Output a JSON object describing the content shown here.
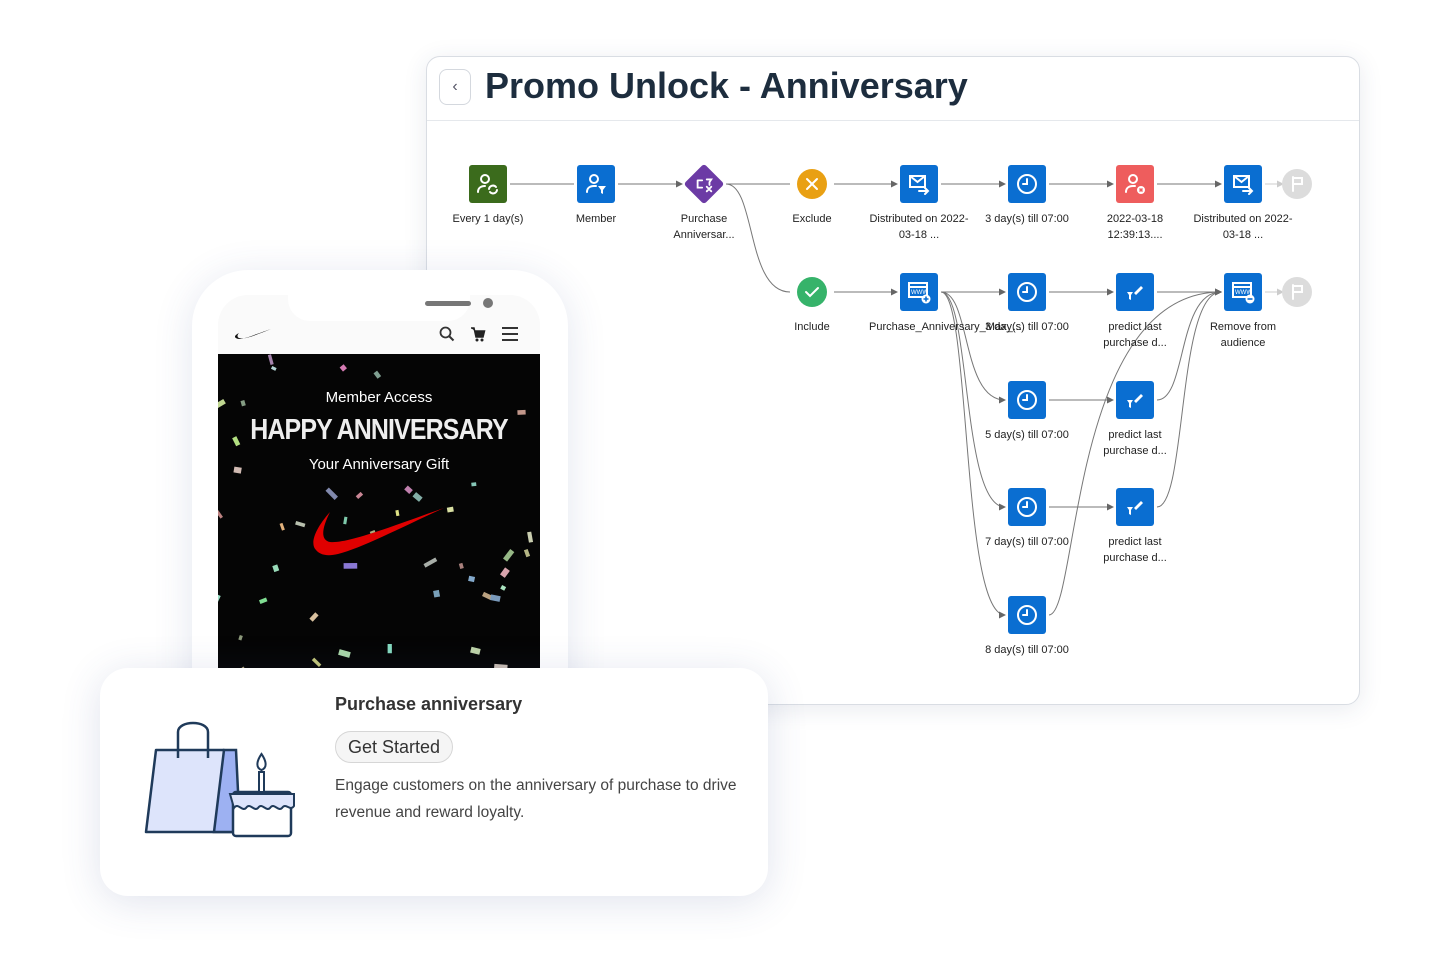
{
  "header": {
    "title": "Promo Unlock - Anniversary",
    "back_icon": "chevron-left-icon"
  },
  "colors": {
    "green": "#3b6b1c",
    "blue": "#0a6ed1",
    "purple": "#6c3ba5",
    "orange": "#e9a013",
    "success": "#36b36a",
    "red": "#ee5d5d",
    "flag": "#dcdcdc",
    "title": "#1d2d3e"
  },
  "flow": {
    "nodes": [
      {
        "id": "every",
        "label": "Every 1 day(s)",
        "icon": "user-refresh-icon"
      },
      {
        "id": "member",
        "label": "Member",
        "icon": "user-filter-icon"
      },
      {
        "id": "purchase",
        "label": "Purchase Anniversar...",
        "icon": "split-filter-icon"
      },
      {
        "id": "exclude",
        "label": "Exclude",
        "icon": "x-circle-icon"
      },
      {
        "id": "dist1",
        "label": "Distributed on 2022-03-18 ...",
        "icon": "email-send-icon"
      },
      {
        "id": "wait1",
        "label": "3 day(s) till 07:00",
        "icon": "clock-icon"
      },
      {
        "id": "remove1",
        "label": "2022-03-18 12:39:13....",
        "icon": "user-remove-icon"
      },
      {
        "id": "dist2",
        "label": "Distributed on 2022-03-18 ...",
        "icon": "email-send-icon"
      },
      {
        "id": "end1",
        "label": "",
        "icon": "flag-icon"
      },
      {
        "id": "include",
        "label": "Include",
        "icon": "check-circle-icon"
      },
      {
        "id": "web",
        "label": "Purchase_Anniversary_Max_...",
        "icon": "web-add-icon"
      },
      {
        "id": "wait3",
        "label": "3 day(s) till 07:00",
        "icon": "clock-icon"
      },
      {
        "id": "pred1",
        "label": "predict last purchase d...",
        "icon": "predict-icon"
      },
      {
        "id": "removeaud",
        "label": "Remove from audience",
        "icon": "web-remove-icon"
      },
      {
        "id": "end2",
        "label": "",
        "icon": "flag-icon"
      },
      {
        "id": "wait5",
        "label": "5 day(s) till 07:00",
        "icon": "clock-icon"
      },
      {
        "id": "pred2",
        "label": "predict last purchase d...",
        "icon": "predict-icon"
      },
      {
        "id": "wait7",
        "label": "7 day(s) till 07:00",
        "icon": "clock-icon"
      },
      {
        "id": "pred3",
        "label": "predict last purchase d...",
        "icon": "predict-icon"
      },
      {
        "id": "wait8",
        "label": "8 day(s) till 07:00",
        "icon": "clock-icon"
      }
    ]
  },
  "phone": {
    "nav_icons": [
      "nike-logo-icon",
      "search-icon",
      "cart-icon",
      "menu-icon"
    ],
    "eyebrow": "Member Access",
    "headline": "HAPPY ANNIVERSARY",
    "subtitle": "Your Anniversary Gift",
    "brand_color": "#e00000"
  },
  "card": {
    "title": "Purchase anniversary",
    "button": "Get Started",
    "description": "Engage customers on the anniversary of purchase to drive revenue and reward loyalty.",
    "illustration": "shopping-bag-cake-icon"
  }
}
